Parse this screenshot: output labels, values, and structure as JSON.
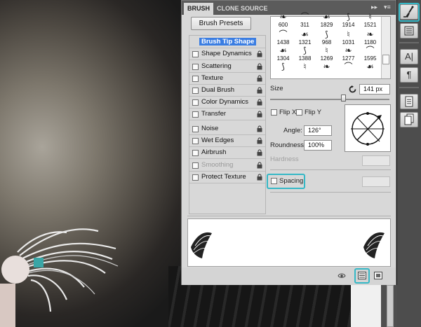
{
  "tabs": {
    "brush": "BRUSH",
    "clone_source": "CLONE SOURCE"
  },
  "tabbar_controls": {
    "expand": "▸▸",
    "menu": "▾≡"
  },
  "brush_presets_button": "Brush Presets",
  "options": [
    {
      "label": "Brush Tip Shape",
      "selected": true,
      "checkbox": false,
      "lock": false,
      "disabled": false
    },
    {
      "label": "Shape Dynamics",
      "selected": false,
      "checkbox": true,
      "lock": true,
      "disabled": false
    },
    {
      "label": "Scattering",
      "selected": false,
      "checkbox": true,
      "lock": true,
      "disabled": false
    },
    {
      "label": "Texture",
      "selected": false,
      "checkbox": true,
      "lock": true,
      "disabled": false
    },
    {
      "label": "Dual Brush",
      "selected": false,
      "checkbox": true,
      "lock": true,
      "disabled": false
    },
    {
      "label": "Color Dynamics",
      "selected": false,
      "checkbox": true,
      "lock": true,
      "disabled": false
    },
    {
      "label": "Transfer",
      "selected": false,
      "checkbox": true,
      "lock": true,
      "disabled": false
    },
    {
      "label": "Noise",
      "selected": false,
      "checkbox": true,
      "lock": true,
      "disabled": false
    },
    {
      "label": "Wet Edges",
      "selected": false,
      "checkbox": true,
      "lock": true,
      "disabled": false
    },
    {
      "label": "Airbrush",
      "selected": false,
      "checkbox": true,
      "lock": true,
      "disabled": false
    },
    {
      "label": "Smoothing",
      "selected": false,
      "checkbox": true,
      "lock": true,
      "disabled": true
    },
    {
      "label": "Protect Texture",
      "selected": false,
      "checkbox": true,
      "lock": true,
      "disabled": false
    }
  ],
  "brush_tips": [
    [
      "600",
      "311",
      "1829",
      "1914",
      "1521"
    ],
    [
      "1438",
      "1321",
      "968",
      "1031",
      "1180"
    ],
    [
      "1304",
      "1388",
      "1269",
      "1277",
      "1595"
    ],
    [
      "",
      "",
      "",
      "",
      ""
    ]
  ],
  "size": {
    "label": "Size",
    "value": "141 px",
    "reset_icon": "reset-icon"
  },
  "flip_x": "Flip X",
  "flip_y": "Flip Y",
  "angle": {
    "label": "Angle:",
    "value": "126°"
  },
  "roundness": {
    "label": "Roundness:",
    "value": "100%"
  },
  "hardness": {
    "label": "Hardness"
  },
  "spacing": {
    "label": "Spacing"
  },
  "highlight_color": "#35b8c6",
  "right_toolbar_icons": [
    "brush-tool-icon",
    "brush-presets-icon",
    "character-icon",
    "paragraph-icon",
    "document-icon",
    "layers-icon"
  ]
}
